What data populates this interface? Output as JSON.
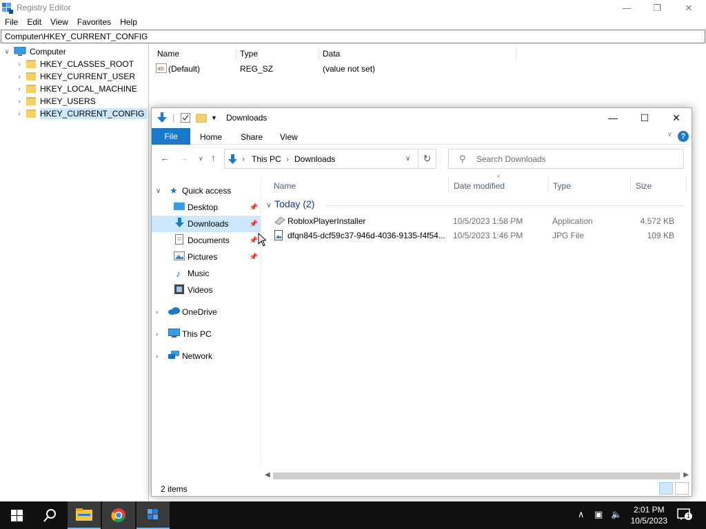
{
  "registry": {
    "title": "Registry Editor",
    "menu": [
      "File",
      "Edit",
      "View",
      "Favorites",
      "Help"
    ],
    "address": "Computer\\HKEY_CURRENT_CONFIG",
    "tree": {
      "root": "Computer",
      "keys": [
        "HKEY_CLASSES_ROOT",
        "HKEY_CURRENT_USER",
        "HKEY_LOCAL_MACHINE",
        "HKEY_USERS",
        "HKEY_CURRENT_CONFIG"
      ],
      "selected": "HKEY_CURRENT_CONFIG"
    },
    "columns": [
      "Name",
      "Type",
      "Data"
    ],
    "values": [
      {
        "name": "(Default)",
        "type": "REG_SZ",
        "data": "(value not set)"
      }
    ]
  },
  "explorer": {
    "title": "Downloads",
    "ribbon": {
      "file": "File",
      "tabs": [
        "Home",
        "Share",
        "View"
      ],
      "help": "?"
    },
    "address": {
      "crumbs": [
        "This PC",
        "Downloads"
      ]
    },
    "search_placeholder": "Search Downloads",
    "nav": {
      "quick_access": "Quick access",
      "pinned": [
        "Desktop",
        "Downloads",
        "Documents",
        "Pictures"
      ],
      "others": [
        "Music",
        "Videos"
      ],
      "roots": [
        "OneDrive",
        "This PC",
        "Network"
      ],
      "selected": "Downloads"
    },
    "columns": [
      "Name",
      "Date modified",
      "Type",
      "Size"
    ],
    "group": "Today (2)",
    "files": [
      {
        "name": "RobloxPlayerInstaller",
        "date": "10/5/2023 1:58 PM",
        "type": "Application",
        "size": "4,572 KB",
        "icon": "installer-icon"
      },
      {
        "name": "dfqn845-dcf59c37-946d-4036-9135-f4f54...",
        "date": "10/5/2023 1:46 PM",
        "type": "JPG File",
        "size": "109 KB",
        "icon": "image-file-icon"
      }
    ],
    "status": "2 items",
    "accent": "#1979ca"
  },
  "taskbar": {
    "time": "2:01 PM",
    "date": "10/5/2023",
    "notification_count": "1"
  }
}
